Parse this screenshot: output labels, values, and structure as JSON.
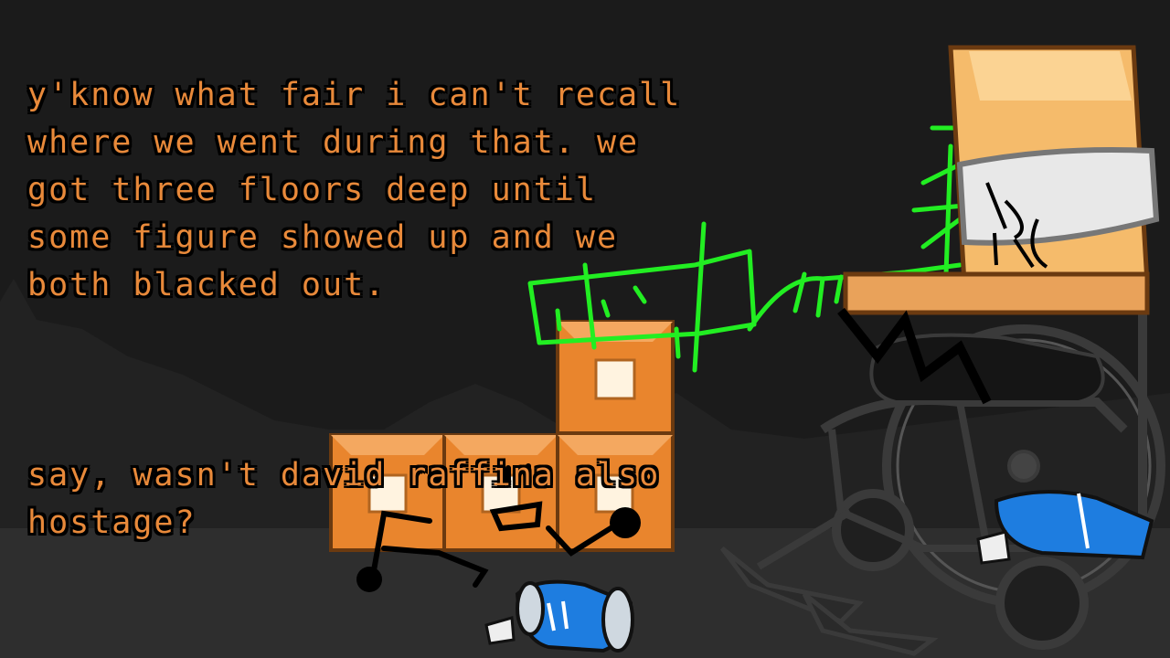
{
  "dialogue": {
    "paragraph_1": "y'know what fair i can't recall\nwhere we went during that. we\ngot three floors deep until\nsome figure showed up and we\nboth blacked out.",
    "paragraph_2": "say, wasn't david raffina also\nhostage?"
  },
  "colors": {
    "background": "#1b1b1b",
    "text": "#e8893a",
    "block": "#e9852d",
    "scribble": "#22ee22",
    "box_character": "#f5bb6b",
    "pipe_blue": "#1e7de0"
  },
  "characters": [
    {
      "icon": "orange-block-stack-character"
    },
    {
      "icon": "green-scribble-character"
    },
    {
      "icon": "box-character-with-bandage"
    },
    {
      "icon": "wheelchair-icon"
    },
    {
      "icon": "blue-pipe-character"
    }
  ]
}
